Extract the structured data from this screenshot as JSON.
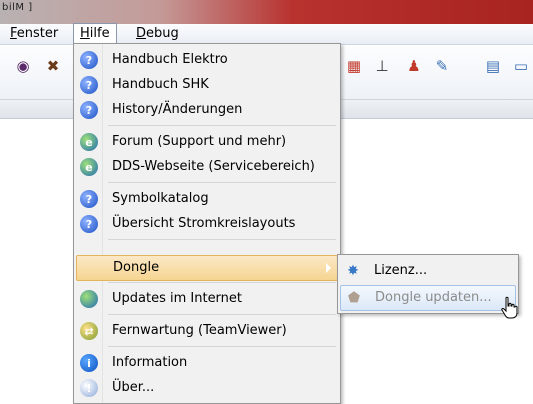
{
  "window": {
    "title_fragment": "bilM ]"
  },
  "menubar": {
    "items": [
      {
        "label": "Fenster",
        "accel": "F"
      },
      {
        "label": "Hilfe",
        "accel": "H"
      },
      {
        "label": "Debug",
        "accel": "D"
      }
    ]
  },
  "help_menu": {
    "items": [
      {
        "label": "Handbuch Elektro",
        "icon": "help-icon"
      },
      {
        "label": "Handbuch SHK",
        "icon": "help-icon"
      },
      {
        "label": "History/Änderungen",
        "icon": "help-icon"
      },
      {
        "label": "Forum (Support und mehr)",
        "icon": "web-globe-icon"
      },
      {
        "label": "DDS-Webseite (Servicebereich)",
        "icon": "web-globe-icon"
      },
      {
        "label": "Symbolkatalog",
        "icon": "help-icon"
      },
      {
        "label": "Übersicht Stromkreislayouts",
        "icon": "help-icon"
      },
      {
        "label": "Dongle",
        "icon": ""
      },
      {
        "label": "Updates im Internet",
        "icon": "globe-icon"
      },
      {
        "label": "Fernwartung (TeamViewer)",
        "icon": "teamviewer-icon"
      },
      {
        "label": "Information",
        "icon": "info-icon"
      },
      {
        "label": "Über...",
        "icon": "about-icon"
      }
    ]
  },
  "dongle_submenu": {
    "items": [
      {
        "label": "Lizenz...",
        "icon": "license-gear-icon",
        "enabled": true
      },
      {
        "label": "Dongle updaten...",
        "icon": "dongle-update-icon",
        "enabled": false
      }
    ]
  },
  "colors": {
    "highlight_orange": "#f6d591",
    "highlight_blue": "#dce8f7",
    "menu_bg": "#f1f1f1"
  }
}
